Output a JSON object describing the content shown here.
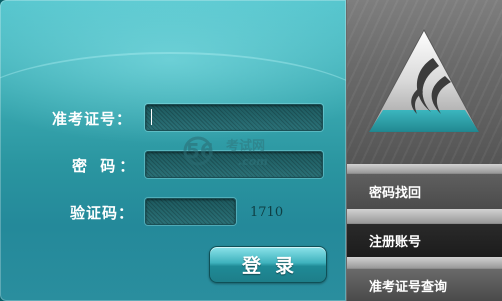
{
  "form": {
    "exam_id_label": "准考证号：",
    "password_label": "密  码：",
    "captcha_label": "验证码：",
    "exam_id_value": "",
    "password_value": "",
    "captcha_input_value": "",
    "captcha_value": "1710",
    "login_label": "登录"
  },
  "sidebar": {
    "items": [
      {
        "label": "密码找回"
      },
      {
        "label": "注册账号"
      },
      {
        "label": "准考证号查询"
      }
    ]
  },
  "watermark": {
    "brand": "56",
    "site": "考试网",
    "domain": ".com"
  },
  "colors": {
    "panel_teal": "#2a95a0",
    "panel_light": "#58c7cf",
    "sidebar_gray": "#6a6a6a",
    "logo_teal": "#2aa5ae"
  },
  "icons": [
    "logo-triangle-icon"
  ]
}
